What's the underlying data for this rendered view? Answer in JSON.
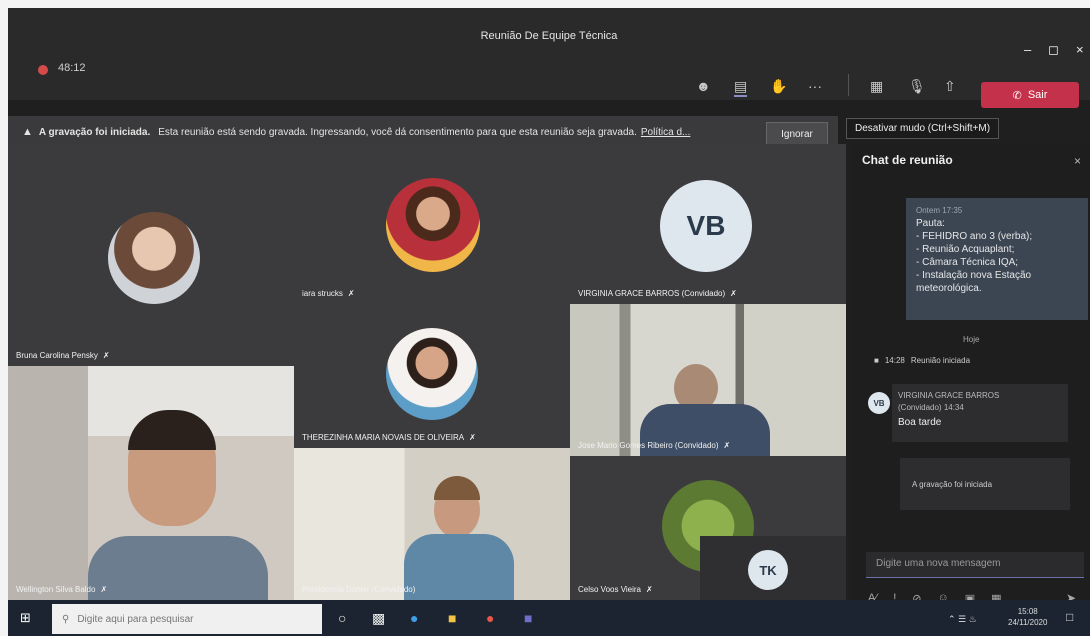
{
  "window": {
    "title": "Reunião De Equipe Técnica",
    "timer": "48:12",
    "minimize_glyph": "–",
    "maximize_glyph": "◻",
    "close_glyph": "×"
  },
  "toolbar": {
    "leave_label": "Sair",
    "more_glyph": "···",
    "tooltip": "Desativar mudo (Ctrl+Shift+M)"
  },
  "banner": {
    "bold": "A gravação foi iniciada.",
    "message": "Esta reunião está sendo gravada. Ingressando, você dá consentimento para que esta reunião seja gravada.",
    "link": "Política d...",
    "ignore_label": "Ignorar"
  },
  "participants": [
    {
      "name": "Bruna Carolina Pensky"
    },
    {
      "name": "iara strucks"
    },
    {
      "name": "VIRGINIA GRACE BARROS (Convidado)",
      "initials": "VB"
    },
    {
      "name": "THEREZINHA MARIA NOVAIS DE OLIVEIRA"
    },
    {
      "name": "Jose Mario Gomes Ribeiro (Convidado)"
    },
    {
      "name": "Wellington Silva Baldo"
    },
    {
      "name": "Presidencia Dohler (Convidado)"
    },
    {
      "name": "Celso Voos Vieira"
    },
    {
      "name": "",
      "initials": "TK"
    }
  ],
  "chat": {
    "title": "Chat de reunião",
    "close_glyph": "×",
    "pinned": {
      "meta": "Ontem 17:35",
      "lines": [
        "Pauta:",
        "- FEHIDRO ano 3 (verba);",
        "- Reunião Acquaplant;",
        "- Câmara Técnica IQA;",
        "- Instalação nova Estação meteorológica."
      ]
    },
    "divider": "Hoje",
    "system_time": "14:28",
    "system_text": "Reunião iniciada",
    "message": {
      "avatar": "VB",
      "author": "VIRGINIA GRACE BARROS",
      "role": "(Convidado)",
      "time": "14:34",
      "body": "Boa tarde"
    },
    "recording_notice": "A gravação foi iniciada",
    "compose_placeholder": "Digite uma nova mensagem"
  },
  "taskbar": {
    "search_placeholder": "Digite aqui para pesquisar",
    "time": "15:08",
    "date": "24/11/2020"
  },
  "colors": {
    "leave": "#c4314b",
    "rec": "#d54a4a",
    "chat_card": "#3c4653"
  }
}
